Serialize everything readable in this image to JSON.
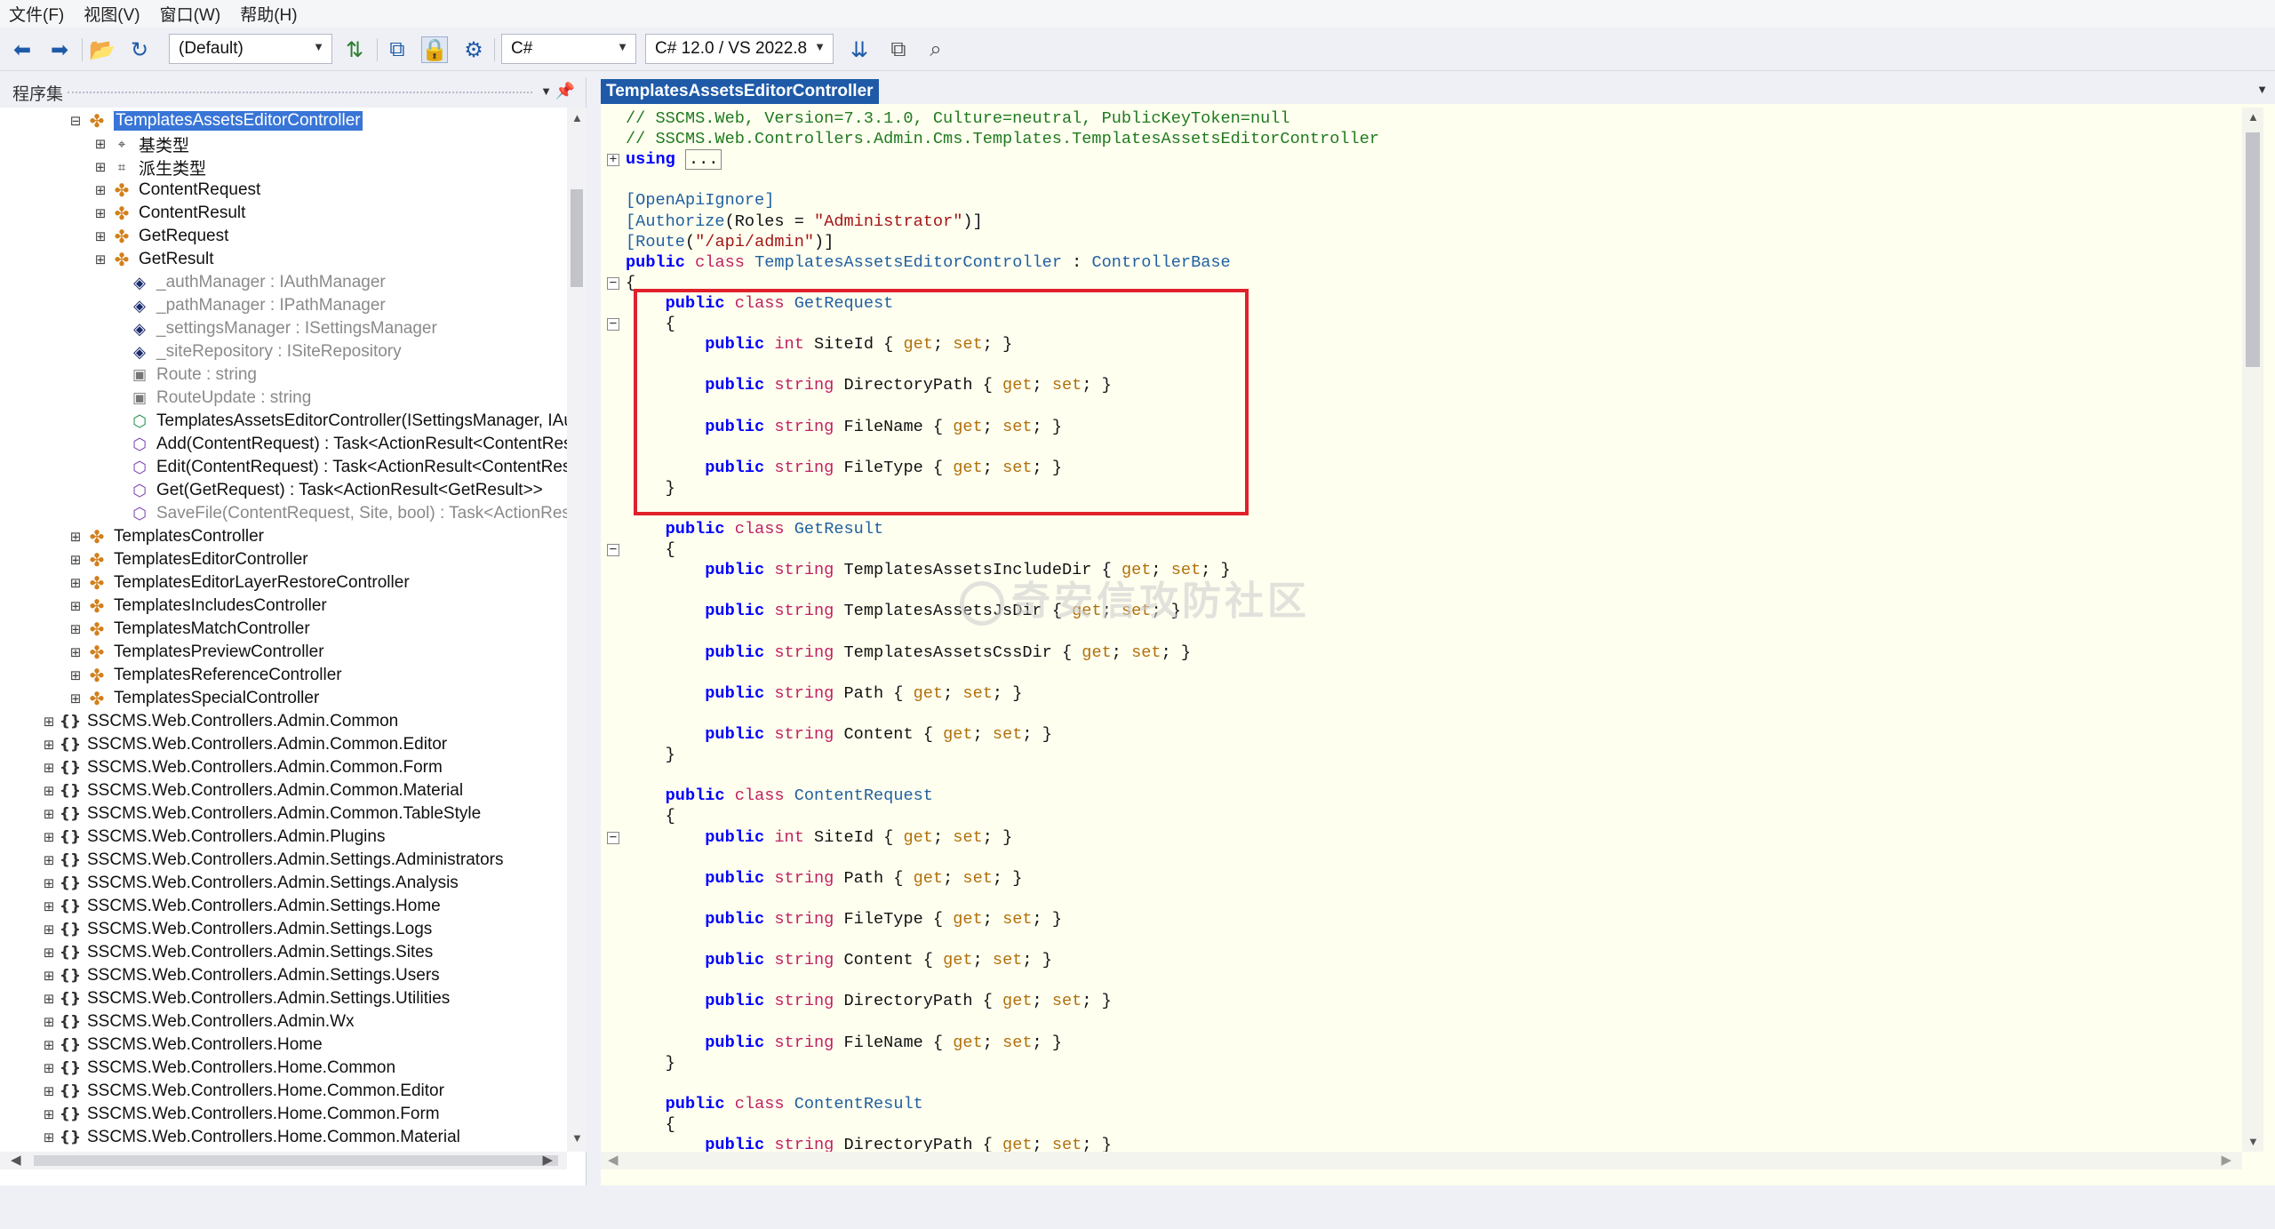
{
  "menu": [
    "文件(F)",
    "视图(V)",
    "窗口(W)",
    "帮助(H)"
  ],
  "toolbar": {
    "profile": "(Default)",
    "language": "C#",
    "lang_version": "C# 12.0 / VS 2022.8"
  },
  "assembly_panel": {
    "title": "程序集",
    "tree": [
      {
        "label": "TemplatesAssetsEditorController",
        "icon": "class-icon",
        "selected": true,
        "expander": "−"
      },
      {
        "label": "基类型",
        "icon": "base-types-icon",
        "expander": "+"
      },
      {
        "label": "派生类型",
        "icon": "derived-types-icon",
        "expander": "+"
      },
      {
        "label": "ContentRequest",
        "icon": "class-icon",
        "expander": "+"
      },
      {
        "label": "ContentResult",
        "icon": "class-icon",
        "expander": "+"
      },
      {
        "label": "GetRequest",
        "icon": "class-icon",
        "expander": "+"
      },
      {
        "label": "GetResult",
        "icon": "class-icon",
        "expander": "+"
      },
      {
        "label": "_authManager : IAuthManager",
        "icon": "private-field-icon",
        "gray": true
      },
      {
        "label": "_pathManager : IPathManager",
        "icon": "private-field-icon",
        "gray": true
      },
      {
        "label": "_settingsManager : ISettingsManager",
        "icon": "private-field-icon",
        "gray": true
      },
      {
        "label": "_siteRepository : ISiteRepository",
        "icon": "private-field-icon",
        "gray": true
      },
      {
        "label": "Route : string",
        "icon": "private-constant-icon",
        "gray": true
      },
      {
        "label": "RouteUpdate : string",
        "icon": "private-constant-icon",
        "gray": true
      },
      {
        "label": "TemplatesAssetsEditorController(ISettingsManager, IAu",
        "icon": "constructor-icon"
      },
      {
        "label": "Add(ContentRequest) : Task<ActionResult<ContentRes",
        "icon": "method-icon"
      },
      {
        "label": "Edit(ContentRequest) : Task<ActionResult<ContentRes",
        "icon": "method-icon"
      },
      {
        "label": "Get(GetRequest) : Task<ActionResult<GetResult>>",
        "icon": "method-icon"
      },
      {
        "label": "SaveFile(ContentRequest, Site, bool) : Task<ActionResu",
        "icon": "private-method-icon",
        "gray": true
      },
      {
        "label": "TemplatesController",
        "icon": "class-icon",
        "expander": "+"
      },
      {
        "label": "TemplatesEditorController",
        "icon": "class-icon",
        "expander": "+"
      },
      {
        "label": "TemplatesEditorLayerRestoreController",
        "icon": "class-icon",
        "expander": "+"
      },
      {
        "label": "TemplatesIncludesController",
        "icon": "class-icon",
        "expander": "+"
      },
      {
        "label": "TemplatesMatchController",
        "icon": "class-icon",
        "expander": "+"
      },
      {
        "label": "TemplatesPreviewController",
        "icon": "class-icon",
        "expander": "+"
      },
      {
        "label": "TemplatesReferenceController",
        "icon": "class-icon",
        "expander": "+"
      },
      {
        "label": "TemplatesSpecialController",
        "icon": "class-icon",
        "expander": "+"
      },
      {
        "label": "SSCMS.Web.Controllers.Admin.Common",
        "icon": "namespace-icon",
        "expander": "+"
      },
      {
        "label": "SSCMS.Web.Controllers.Admin.Common.Editor",
        "icon": "namespace-icon",
        "expander": "+"
      },
      {
        "label": "SSCMS.Web.Controllers.Admin.Common.Form",
        "icon": "namespace-icon",
        "expander": "+"
      },
      {
        "label": "SSCMS.Web.Controllers.Admin.Common.Material",
        "icon": "namespace-icon",
        "expander": "+"
      },
      {
        "label": "SSCMS.Web.Controllers.Admin.Common.TableStyle",
        "icon": "namespace-icon",
        "expander": "+"
      },
      {
        "label": "SSCMS.Web.Controllers.Admin.Plugins",
        "icon": "namespace-icon",
        "expander": "+"
      },
      {
        "label": "SSCMS.Web.Controllers.Admin.Settings.Administrators",
        "icon": "namespace-icon",
        "expander": "+"
      },
      {
        "label": "SSCMS.Web.Controllers.Admin.Settings.Analysis",
        "icon": "namespace-icon",
        "expander": "+"
      },
      {
        "label": "SSCMS.Web.Controllers.Admin.Settings.Home",
        "icon": "namespace-icon",
        "expander": "+"
      },
      {
        "label": "SSCMS.Web.Controllers.Admin.Settings.Logs",
        "icon": "namespace-icon",
        "expander": "+"
      },
      {
        "label": "SSCMS.Web.Controllers.Admin.Settings.Sites",
        "icon": "namespace-icon",
        "expander": "+"
      },
      {
        "label": "SSCMS.Web.Controllers.Admin.Settings.Users",
        "icon": "namespace-icon",
        "expander": "+"
      },
      {
        "label": "SSCMS.Web.Controllers.Admin.Settings.Utilities",
        "icon": "namespace-icon",
        "expander": "+"
      },
      {
        "label": "SSCMS.Web.Controllers.Admin.Wx",
        "icon": "namespace-icon",
        "expander": "+"
      },
      {
        "label": "SSCMS.Web.Controllers.Home",
        "icon": "namespace-icon",
        "expander": "+"
      },
      {
        "label": "SSCMS.Web.Controllers.Home.Common",
        "icon": "namespace-icon",
        "expander": "+"
      },
      {
        "label": "SSCMS.Web.Controllers.Home.Common.Editor",
        "icon": "namespace-icon",
        "expander": "+"
      },
      {
        "label": "SSCMS.Web.Controllers.Home.Common.Form",
        "icon": "namespace-icon",
        "expander": "+"
      },
      {
        "label": "SSCMS.Web.Controllers.Home.Common.Material",
        "icon": "namespace-icon",
        "expander": "+"
      }
    ]
  },
  "editor": {
    "tab_title": "TemplatesAssetsEditorController",
    "lines": [
      [
        [
          "cm",
          "// SSCMS.Web, Version=7.3.1.0, Culture=neutral, PublicKeyToken=null"
        ]
      ],
      [
        [
          "cm",
          "// SSCMS.Web.Controllers.Admin.Cms.Templates.TemplatesAssetsEditorController"
        ]
      ],
      [
        [
          "kw",
          "using"
        ],
        [
          "",
          " "
        ],
        [
          "box",
          "..."
        ]
      ],
      [
        [
          "",
          ""
        ]
      ],
      [
        [
          "att",
          "[OpenApiIgnore]"
        ]
      ],
      [
        [
          "att",
          "[Authorize"
        ],
        [
          "",
          "(Roles = "
        ],
        [
          "str",
          "\"Administrator\""
        ],
        [
          "",
          ")]"
        ]
      ],
      [
        [
          "att",
          "[Route"
        ],
        [
          "",
          "("
        ],
        [
          "str",
          "\"/api/admin\""
        ],
        [
          "",
          ")]"
        ]
      ],
      [
        [
          "kw",
          "public"
        ],
        [
          "",
          " "
        ],
        [
          "kw2",
          "class"
        ],
        [
          "",
          " "
        ],
        [
          "typ",
          "TemplatesAssetsEditorController"
        ],
        [
          "",
          " : "
        ],
        [
          "typ",
          "ControllerBase"
        ]
      ],
      [
        [
          "",
          "{"
        ]
      ],
      [
        [
          "",
          "    "
        ],
        [
          "kw",
          "public"
        ],
        [
          "",
          " "
        ],
        [
          "kw2",
          "class"
        ],
        [
          "",
          " "
        ],
        [
          "typ",
          "GetRequest"
        ]
      ],
      [
        [
          "",
          "    {"
        ]
      ],
      [
        [
          "",
          "        "
        ],
        [
          "kw",
          "public"
        ],
        [
          "",
          " "
        ],
        [
          "kw2",
          "int"
        ],
        [
          "",
          " SiteId { "
        ],
        [
          "acc",
          "get"
        ],
        [
          "",
          "; "
        ],
        [
          "acc",
          "set"
        ],
        [
          "",
          "; }"
        ]
      ],
      [
        [
          "",
          ""
        ]
      ],
      [
        [
          "",
          "        "
        ],
        [
          "kw",
          "public"
        ],
        [
          "",
          " "
        ],
        [
          "kw2",
          "string"
        ],
        [
          "",
          " DirectoryPath { "
        ],
        [
          "acc",
          "get"
        ],
        [
          "",
          "; "
        ],
        [
          "acc",
          "set"
        ],
        [
          "",
          "; }"
        ]
      ],
      [
        [
          "",
          ""
        ]
      ],
      [
        [
          "",
          "        "
        ],
        [
          "kw",
          "public"
        ],
        [
          "",
          " "
        ],
        [
          "kw2",
          "string"
        ],
        [
          "",
          " FileName { "
        ],
        [
          "acc",
          "get"
        ],
        [
          "",
          "; "
        ],
        [
          "acc",
          "set"
        ],
        [
          "",
          "; }"
        ]
      ],
      [
        [
          "",
          ""
        ]
      ],
      [
        [
          "",
          "        "
        ],
        [
          "kw",
          "public"
        ],
        [
          "",
          " "
        ],
        [
          "kw2",
          "string"
        ],
        [
          "",
          " FileType { "
        ],
        [
          "acc",
          "get"
        ],
        [
          "",
          "; "
        ],
        [
          "acc",
          "set"
        ],
        [
          "",
          "; }"
        ]
      ],
      [
        [
          "",
          "    }"
        ]
      ],
      [
        [
          "",
          ""
        ]
      ],
      [
        [
          "",
          "    "
        ],
        [
          "kw",
          "public"
        ],
        [
          "",
          " "
        ],
        [
          "kw2",
          "class"
        ],
        [
          "",
          " "
        ],
        [
          "typ",
          "GetResult"
        ]
      ],
      [
        [
          "",
          "    {"
        ]
      ],
      [
        [
          "",
          "        "
        ],
        [
          "kw",
          "public"
        ],
        [
          "",
          " "
        ],
        [
          "kw2",
          "string"
        ],
        [
          "",
          " TemplatesAssetsIncludeDir { "
        ],
        [
          "acc",
          "get"
        ],
        [
          "",
          "; "
        ],
        [
          "acc",
          "set"
        ],
        [
          "",
          "; }"
        ]
      ],
      [
        [
          "",
          ""
        ]
      ],
      [
        [
          "",
          "        "
        ],
        [
          "kw",
          "public"
        ],
        [
          "",
          " "
        ],
        [
          "kw2",
          "string"
        ],
        [
          "",
          " TemplatesAssetsJsDir { "
        ],
        [
          "acc",
          "get"
        ],
        [
          "",
          "; "
        ],
        [
          "acc",
          "set"
        ],
        [
          "",
          "; }"
        ]
      ],
      [
        [
          "",
          ""
        ]
      ],
      [
        [
          "",
          "        "
        ],
        [
          "kw",
          "public"
        ],
        [
          "",
          " "
        ],
        [
          "kw2",
          "string"
        ],
        [
          "",
          " TemplatesAssetsCssDir { "
        ],
        [
          "acc",
          "get"
        ],
        [
          "",
          "; "
        ],
        [
          "acc",
          "set"
        ],
        [
          "",
          "; }"
        ]
      ],
      [
        [
          "",
          ""
        ]
      ],
      [
        [
          "",
          "        "
        ],
        [
          "kw",
          "public"
        ],
        [
          "",
          " "
        ],
        [
          "kw2",
          "string"
        ],
        [
          "",
          " Path { "
        ],
        [
          "acc",
          "get"
        ],
        [
          "",
          "; "
        ],
        [
          "acc",
          "set"
        ],
        [
          "",
          "; }"
        ]
      ],
      [
        [
          "",
          ""
        ]
      ],
      [
        [
          "",
          "        "
        ],
        [
          "kw",
          "public"
        ],
        [
          "",
          " "
        ],
        [
          "kw2",
          "string"
        ],
        [
          "",
          " Content { "
        ],
        [
          "acc",
          "get"
        ],
        [
          "",
          "; "
        ],
        [
          "acc",
          "set"
        ],
        [
          "",
          "; }"
        ]
      ],
      [
        [
          "",
          "    }"
        ]
      ],
      [
        [
          "",
          ""
        ]
      ],
      [
        [
          "",
          "    "
        ],
        [
          "kw",
          "public"
        ],
        [
          "",
          " "
        ],
        [
          "kw2",
          "class"
        ],
        [
          "",
          " "
        ],
        [
          "typ",
          "ContentRequest"
        ]
      ],
      [
        [
          "",
          "    {"
        ]
      ],
      [
        [
          "",
          "        "
        ],
        [
          "kw",
          "public"
        ],
        [
          "",
          " "
        ],
        [
          "kw2",
          "int"
        ],
        [
          "",
          " SiteId { "
        ],
        [
          "acc",
          "get"
        ],
        [
          "",
          "; "
        ],
        [
          "acc",
          "set"
        ],
        [
          "",
          "; }"
        ]
      ],
      [
        [
          "",
          ""
        ]
      ],
      [
        [
          "",
          "        "
        ],
        [
          "kw",
          "public"
        ],
        [
          "",
          " "
        ],
        [
          "kw2",
          "string"
        ],
        [
          "",
          " Path { "
        ],
        [
          "acc",
          "get"
        ],
        [
          "",
          "; "
        ],
        [
          "acc",
          "set"
        ],
        [
          "",
          "; }"
        ]
      ],
      [
        [
          "",
          ""
        ]
      ],
      [
        [
          "",
          "        "
        ],
        [
          "kw",
          "public"
        ],
        [
          "",
          " "
        ],
        [
          "kw2",
          "string"
        ],
        [
          "",
          " FileType { "
        ],
        [
          "acc",
          "get"
        ],
        [
          "",
          "; "
        ],
        [
          "acc",
          "set"
        ],
        [
          "",
          "; }"
        ]
      ],
      [
        [
          "",
          ""
        ]
      ],
      [
        [
          "",
          "        "
        ],
        [
          "kw",
          "public"
        ],
        [
          "",
          " "
        ],
        [
          "kw2",
          "string"
        ],
        [
          "",
          " Content { "
        ],
        [
          "acc",
          "get"
        ],
        [
          "",
          "; "
        ],
        [
          "acc",
          "set"
        ],
        [
          "",
          "; }"
        ]
      ],
      [
        [
          "",
          ""
        ]
      ],
      [
        [
          "",
          "        "
        ],
        [
          "kw",
          "public"
        ],
        [
          "",
          " "
        ],
        [
          "kw2",
          "string"
        ],
        [
          "",
          " DirectoryPath { "
        ],
        [
          "acc",
          "get"
        ],
        [
          "",
          "; "
        ],
        [
          "acc",
          "set"
        ],
        [
          "",
          "; }"
        ]
      ],
      [
        [
          "",
          ""
        ]
      ],
      [
        [
          "",
          "        "
        ],
        [
          "kw",
          "public"
        ],
        [
          "",
          " "
        ],
        [
          "kw2",
          "string"
        ],
        [
          "",
          " FileName { "
        ],
        [
          "acc",
          "get"
        ],
        [
          "",
          "; "
        ],
        [
          "acc",
          "set"
        ],
        [
          "",
          "; }"
        ]
      ],
      [
        [
          "",
          "    }"
        ]
      ],
      [
        [
          "",
          ""
        ]
      ],
      [
        [
          "",
          "    "
        ],
        [
          "kw",
          "public"
        ],
        [
          "",
          " "
        ],
        [
          "kw2",
          "class"
        ],
        [
          "",
          " "
        ],
        [
          "typ",
          "ContentResult"
        ]
      ],
      [
        [
          "",
          "    {"
        ]
      ],
      [
        [
          "",
          "        "
        ],
        [
          "kw",
          "public"
        ],
        [
          "",
          " "
        ],
        [
          "kw2",
          "string"
        ],
        [
          "",
          " DirectoryPath { "
        ],
        [
          "acc",
          "get"
        ],
        [
          "",
          "; "
        ],
        [
          "acc",
          "set"
        ],
        [
          "",
          "; }"
        ]
      ]
    ],
    "fold_markers": [
      {
        "line": 2,
        "sign": "+"
      },
      {
        "line": 8,
        "sign": "−"
      },
      {
        "line": 10,
        "sign": "−"
      },
      {
        "line": 21,
        "sign": "−"
      },
      {
        "line": 35,
        "sign": "−"
      },
      {
        "line": 51,
        "sign": "−"
      }
    ],
    "highlight": {
      "from_line": 9,
      "to_line": 18,
      "color": "#e0212b"
    }
  },
  "watermark": "奇安信攻防社区"
}
